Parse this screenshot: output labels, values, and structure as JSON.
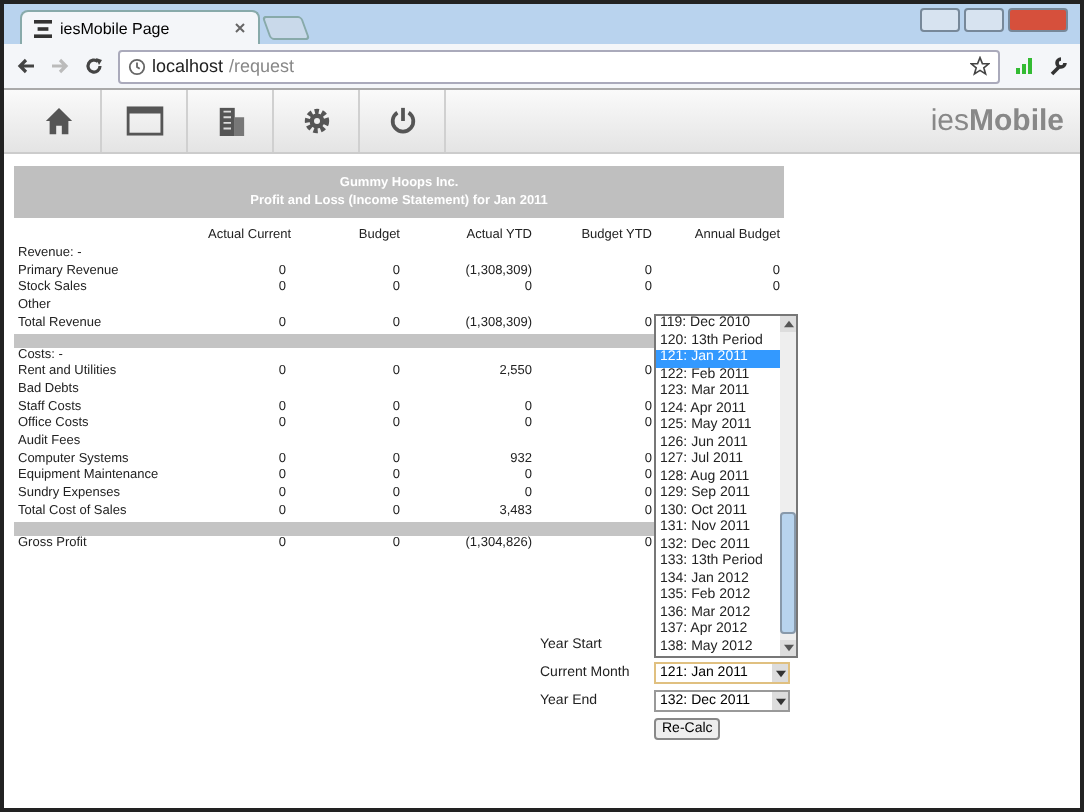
{
  "browser": {
    "tab_title": "iesMobile Page",
    "address_host": "localhost",
    "address_path": "/request"
  },
  "toolbar": {
    "brand": "ies**Mobile**"
  },
  "report": {
    "company": "Gummy Hoops Inc.",
    "title": "Profit and Loss (Income Statement) for Jan 2011",
    "columns": [
      "Actual Current",
      "Budget",
      "Actual YTD",
      "Budget YTD",
      "Annual Budget"
    ],
    "rows": [
      {
        "kind": "section",
        "label": "Revenue: -"
      },
      {
        "kind": "line",
        "label": "Primary Revenue",
        "values": [
          "0",
          "0",
          "(1,308,309)",
          "0",
          "0"
        ]
      },
      {
        "kind": "line",
        "label": "Stock Sales",
        "values": [
          "0",
          "0",
          "0",
          "0",
          "0"
        ]
      },
      {
        "kind": "section",
        "label": "Other"
      },
      {
        "kind": "line",
        "label": "Total Revenue",
        "values": [
          "0",
          "0",
          "(1,308,309)",
          "0"
        ]
      },
      {
        "kind": "spacer"
      },
      {
        "kind": "section",
        "label": "Costs: -"
      },
      {
        "kind": "line",
        "label": "Rent and Utilities",
        "values": [
          "0",
          "0",
          "2,550",
          "0"
        ]
      },
      {
        "kind": "section",
        "label": "Bad Debts"
      },
      {
        "kind": "line",
        "label": "Staff Costs",
        "values": [
          "0",
          "0",
          "0",
          "0"
        ]
      },
      {
        "kind": "line",
        "label": "Office Costs",
        "values": [
          "0",
          "0",
          "0",
          "0"
        ]
      },
      {
        "kind": "section",
        "label": "Audit Fees"
      },
      {
        "kind": "line",
        "label": "Computer Systems",
        "values": [
          "0",
          "0",
          "932",
          "0"
        ]
      },
      {
        "kind": "line",
        "label": "Equipment Maintenance",
        "values": [
          "0",
          "0",
          "0",
          "0"
        ]
      },
      {
        "kind": "line",
        "label": "Sundry Expenses",
        "values": [
          "0",
          "0",
          "0",
          "0"
        ]
      },
      {
        "kind": "line",
        "label": "Total Cost of Sales",
        "values": [
          "0",
          "0",
          "3,483",
          "0"
        ]
      },
      {
        "kind": "spacer"
      },
      {
        "kind": "line",
        "label": "Gross Profit",
        "values": [
          "0",
          "0",
          "(1,304,826)",
          "0"
        ]
      }
    ]
  },
  "controls": {
    "fields": [
      {
        "label": "Year Start",
        "open": true
      },
      {
        "label": "Current Month",
        "value": "121: Jan 2011",
        "open": false
      },
      {
        "label": "Year End",
        "value": "132: Dec 2011",
        "open": false
      }
    ],
    "button": "Re-Calc"
  },
  "dropdown_options": [
    {
      "label": "119: Dec 2010",
      "selected": false
    },
    {
      "label": "120: 13th Period",
      "selected": false
    },
    {
      "label": "121: Jan 2011",
      "selected": true
    },
    {
      "label": "122: Feb 2011",
      "selected": false
    },
    {
      "label": "123: Mar 2011",
      "selected": false
    },
    {
      "label": "124: Apr 2011",
      "selected": false
    },
    {
      "label": "125: May 2011",
      "selected": false
    },
    {
      "label": "126: Jun 2011",
      "selected": false
    },
    {
      "label": "127: Jul 2011",
      "selected": false
    },
    {
      "label": "128: Aug 2011",
      "selected": false
    },
    {
      "label": "129: Sep 2011",
      "selected": false
    },
    {
      "label": "130: Oct 2011",
      "selected": false
    },
    {
      "label": "131: Nov 2011",
      "selected": false
    },
    {
      "label": "132: Dec 2011",
      "selected": false
    },
    {
      "label": "133: 13th Period",
      "selected": false
    },
    {
      "label": "134: Jan 2012",
      "selected": false
    },
    {
      "label": "135: Feb 2012",
      "selected": false
    },
    {
      "label": "136: Mar 2012",
      "selected": false
    },
    {
      "label": "137: Apr 2012",
      "selected": false
    },
    {
      "label": "138: May 2012",
      "selected": false
    }
  ]
}
